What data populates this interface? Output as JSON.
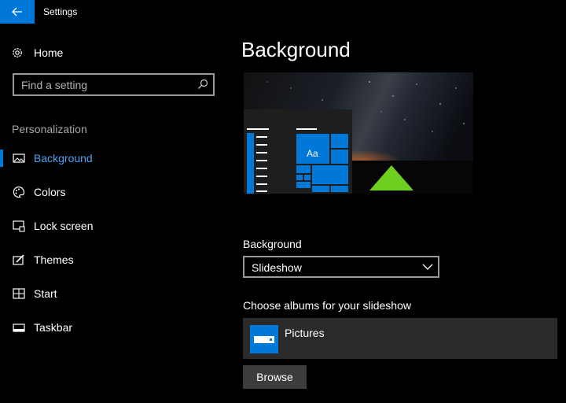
{
  "window": {
    "title": "Settings",
    "back_icon": "arrow-left-icon",
    "accent": "#0078d7"
  },
  "sidebar": {
    "home": {
      "label": "Home",
      "icon": "gear-icon"
    },
    "search": {
      "placeholder": "Find a setting",
      "icon": "search-icon"
    },
    "section": "Personalization",
    "items": [
      {
        "label": "Background",
        "icon": "picture-icon",
        "active": true
      },
      {
        "label": "Colors",
        "icon": "palette-icon"
      },
      {
        "label": "Lock screen",
        "icon": "lock-screen-icon"
      },
      {
        "label": "Themes",
        "icon": "themes-icon"
      },
      {
        "label": "Start",
        "icon": "start-icon"
      },
      {
        "label": "Taskbar",
        "icon": "taskbar-icon"
      }
    ]
  },
  "main": {
    "title": "Background",
    "preview": {
      "tile_text": "Aa"
    },
    "background_label": "Background",
    "background_value": "Slideshow",
    "albums_label": "Choose albums for your slideshow",
    "albums": [
      {
        "name": "Pictures",
        "icon": "folder-icon"
      }
    ],
    "browse_label": "Browse"
  }
}
